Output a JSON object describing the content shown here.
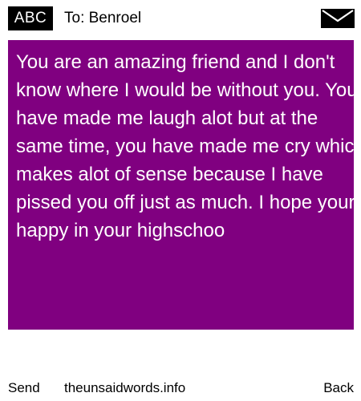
{
  "header": {
    "input_mode": "ABC",
    "recipient": "To: Benroel",
    "message_icon": "envelope-icon"
  },
  "message": {
    "text": "You are an amazing friend and I don't know where I would be without you. You have made me laugh alot but at the same time, you have made me cry which makes alot of sense because I have pissed you off just as much. I hope youre happy in your highschoo"
  },
  "footer": {
    "send_label": "Send",
    "site_label": "theunsaidwords.info",
    "back_label": "Back"
  },
  "colors": {
    "message_background": "#800080",
    "message_text": "#ffffff",
    "badge_background": "#000000"
  }
}
